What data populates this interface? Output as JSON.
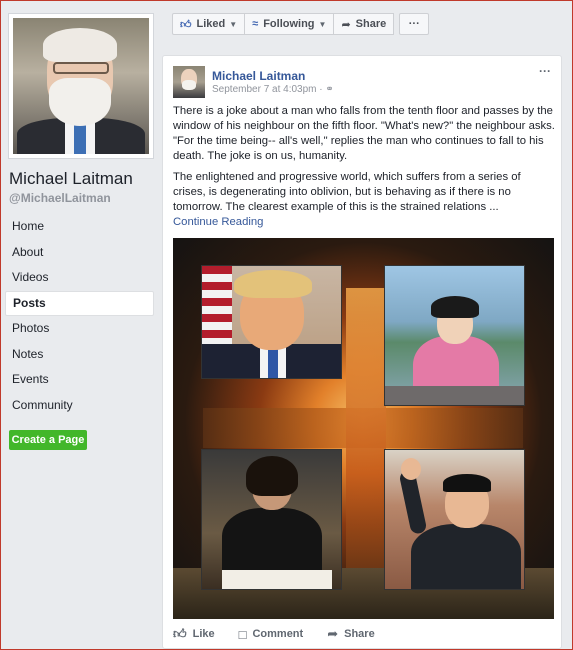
{
  "page": {
    "name": "Michael Laitman",
    "handle": "@MichaelLaitman"
  },
  "sidebar": {
    "items": [
      {
        "label": "Home",
        "active": false
      },
      {
        "label": "About",
        "active": false
      },
      {
        "label": "Videos",
        "active": false
      },
      {
        "label": "Posts",
        "active": true
      },
      {
        "label": "Photos",
        "active": false
      },
      {
        "label": "Notes",
        "active": false
      },
      {
        "label": "Events",
        "active": false
      },
      {
        "label": "Community",
        "active": false
      }
    ],
    "create_page_label": "Create a Page"
  },
  "actionbar": {
    "liked_label": "Liked",
    "following_label": "Following",
    "share_label": "Share",
    "more_label": "···"
  },
  "post": {
    "author": "Michael Laitman",
    "timestamp": "September 7 at 4:03pm · ",
    "privacy_icon": "globe-icon",
    "more_label": "···",
    "paragraph1": "There is a joke about a man who falls from the tenth floor and passes by the window of his neighbour on the fifth floor. \"What's new?\" the neighbour asks. \"For the time being-- all's well,\" replies the man who continues to fall to his death. The joke is on us, humanity.",
    "paragraph2": "The enlightened and progressive world, which suffers from a series of crises, is degenerating into oblivion, but is behaving as if there is no tomorrow. The clearest example of this is the strained relations ...",
    "continue_label": "Continue Reading",
    "actions": {
      "like_label": "Like",
      "comment_label": "Comment",
      "share_label": "Share"
    }
  },
  "colors": {
    "link": "#365899",
    "green_button": "#42b72a",
    "background": "#e9ebee"
  }
}
